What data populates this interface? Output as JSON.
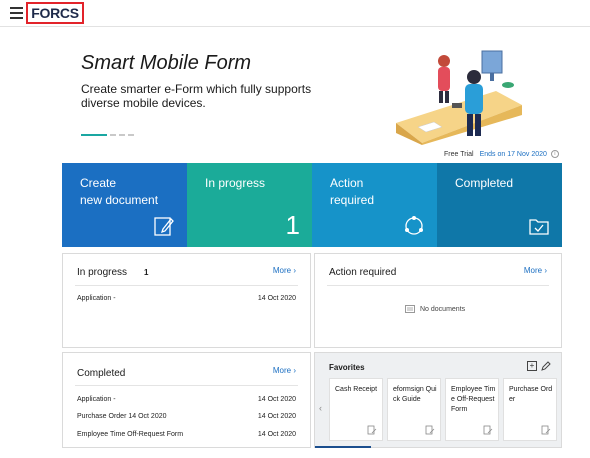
{
  "header": {
    "menu_icon": "hamburger-menu-icon",
    "logo_text": "FORCS"
  },
  "hero": {
    "title": "Smart Mobile Form",
    "subtitle": "Create smarter e-Form which fully supports diverse mobile devices.",
    "slide_count": 4,
    "active_slide": 1
  },
  "trial": {
    "label": "Free Trial",
    "ends": "Ends on 17 Nov 2020",
    "info_icon": "i"
  },
  "tiles": [
    {
      "label_line1": "Create",
      "label_line2": "new document",
      "icon": "edit-document-icon",
      "color": "#1b6fc2"
    },
    {
      "label_line1": "In progress",
      "label_line2": "",
      "count": "1",
      "color": "#1bab99"
    },
    {
      "label_line1": "Action",
      "label_line2": "required",
      "icon": "refresh-circle-icon",
      "color": "#1693c9"
    },
    {
      "label_line1": "Completed",
      "label_line2": "",
      "icon": "folder-check-icon",
      "color": "#0f77a8"
    }
  ],
  "in_progress_panel": {
    "title": "In progress",
    "count": "1",
    "more": "More",
    "rows": [
      {
        "name": "Application -",
        "date": "14 Oct 2020"
      }
    ]
  },
  "action_panel": {
    "title": "Action required",
    "more": "More",
    "empty": "No documents"
  },
  "completed_panel": {
    "title": "Completed",
    "more": "More",
    "rows": [
      {
        "name": "Application -",
        "date": "14 Oct 2020"
      },
      {
        "name": "Purchase Order 14 Oct 2020",
        "date": "14 Oct 2020"
      },
      {
        "name": "Employee Time Off-Request Form",
        "date": "14 Oct 2020"
      }
    ]
  },
  "favorites": {
    "title": "Favorites",
    "cards": [
      {
        "label": "Cash Receipt"
      },
      {
        "label": "eformsign Quick Guide"
      },
      {
        "label": "Employee Time Off-Request Form"
      },
      {
        "label": "Purchase Order"
      }
    ]
  },
  "colors": {
    "accent": "#1b6fc2",
    "logo_border": "#e2232a",
    "slider_active": "#1aa7a2"
  }
}
